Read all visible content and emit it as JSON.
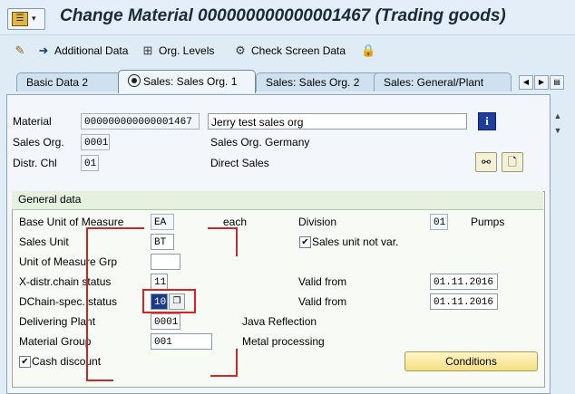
{
  "title": "Change Material 000000000000001467 (Trading goods)",
  "toolbar": {
    "additional_data": "Additional Data",
    "org_levels": "Org. Levels",
    "check_screen_data": "Check Screen Data"
  },
  "tabs": [
    {
      "label": "Basic Data 2"
    },
    {
      "label": "Sales: Sales Org. 1",
      "active": true
    },
    {
      "label": "Sales: Sales Org. 2"
    },
    {
      "label": "Sales: General/Plant"
    }
  ],
  "header": {
    "material_label": "Material",
    "material_value": "000000000000001467",
    "material_desc": "Jerry test sales org",
    "sales_org_label": "Sales Org.",
    "sales_org_value": "0001",
    "sales_org_desc": "Sales Org. Germany",
    "distr_chl_label": "Distr. Chl",
    "distr_chl_value": "01",
    "distr_chl_desc": "Direct Sales"
  },
  "general_data": {
    "title": "General data",
    "base_uom_label": "Base Unit of Measure",
    "base_uom_value": "EA",
    "base_uom_desc": "each",
    "division_label": "Division",
    "division_value": "01",
    "division_desc": "Pumps",
    "sales_unit_label": "Sales Unit",
    "sales_unit_value": "BT",
    "sales_unit_not_var_label": "Sales unit not var.",
    "sales_unit_not_var_checked": true,
    "uom_grp_label": "Unit of Measure Grp",
    "uom_grp_value": "",
    "xdistr_label": "X-distr.chain status",
    "xdistr_value": "11",
    "valid_from_label_1": "Valid from",
    "valid_from_value_1": "01.11.2016",
    "dchain_label": "DChain-spec. status",
    "dchain_value": "10",
    "valid_from_label_2": "Valid from",
    "valid_from_value_2": "01.11.2016",
    "delivering_plant_label": "Delivering Plant",
    "delivering_plant_value": "0001",
    "delivering_plant_desc": "Java Reflection",
    "material_group_label": "Material Group",
    "material_group_value": "001",
    "material_group_desc": "Metal processing",
    "cash_discount_label": "Cash discount",
    "cash_discount_checked": true,
    "conditions_button": "Conditions"
  },
  "icons": {
    "title_menu": "menu-icon",
    "additional_data": "arrow-right-icon",
    "org_levels": "org-levels-icon",
    "check_screen": "check-screen-icon",
    "lock": "lock-icon",
    "info": "info-icon",
    "tab_nav_left": "tab-left-icon",
    "tab_nav_right": "tab-right-icon",
    "tab_list": "tab-list-icon"
  },
  "colors": {
    "highlight": "#e02020",
    "conditions_button": "#f4df84",
    "title_bg": "#e3eef8"
  }
}
